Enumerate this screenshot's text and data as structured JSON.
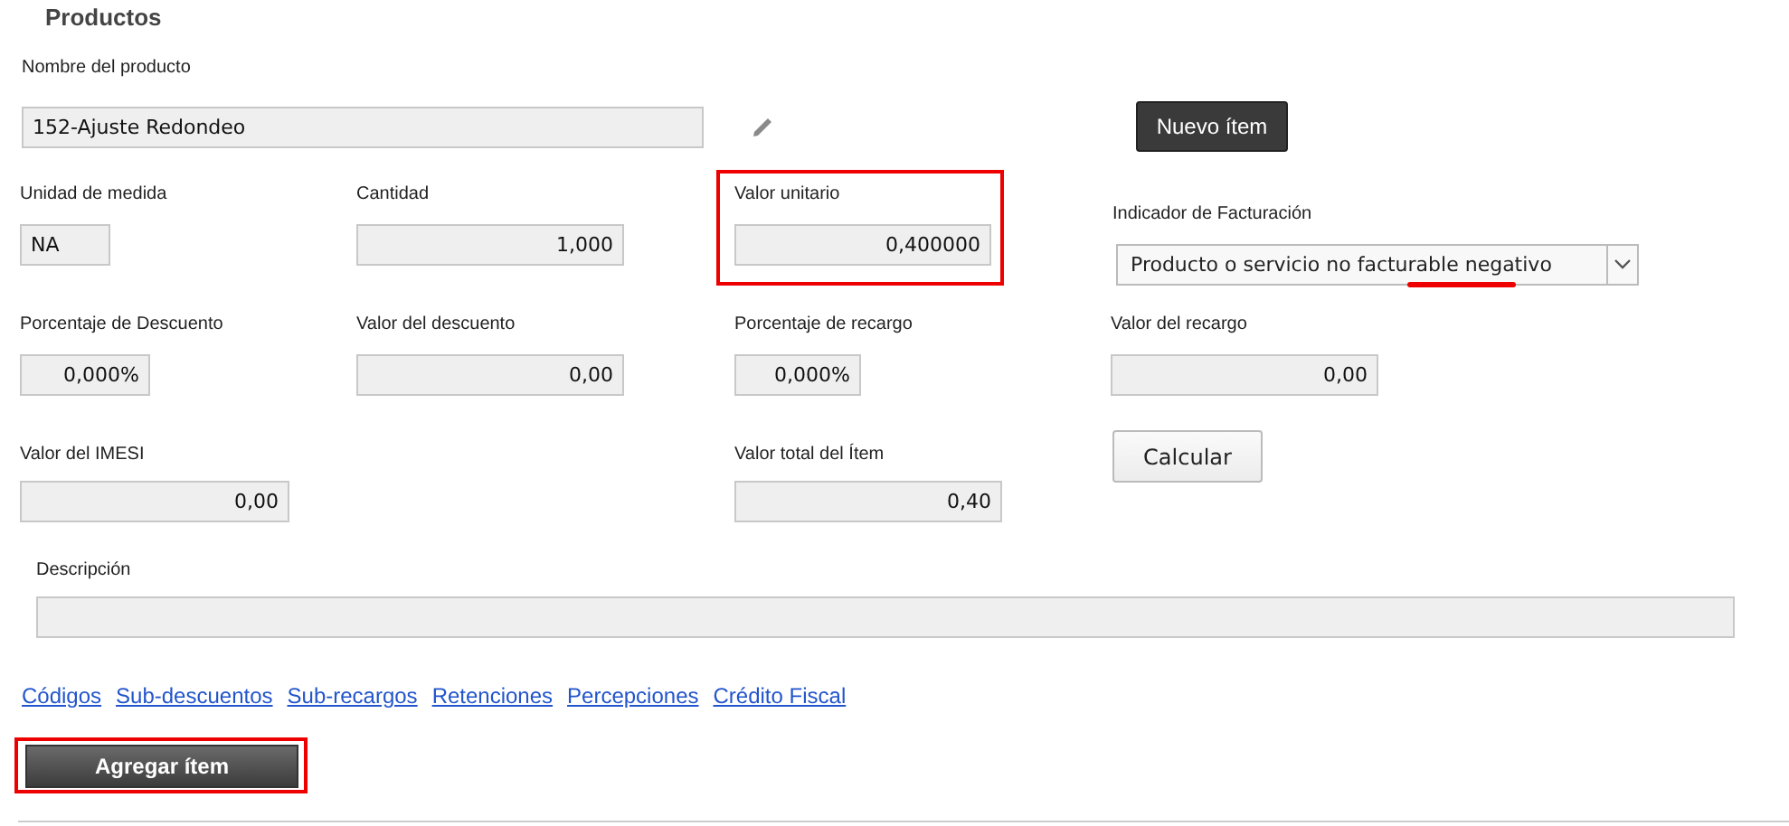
{
  "section_title": "Productos",
  "product_name": {
    "label": "Nombre del producto",
    "value": "152-Ajuste Redondeo"
  },
  "new_item_button": "Nuevo ítem",
  "fields": [
    {
      "label": "Unidad de medida",
      "value": "NA",
      "highlighted": false
    },
    {
      "label": "Cantidad",
      "value": "1,000",
      "highlighted": false
    },
    {
      "label": "Valor unitario",
      "value": "0,400000",
      "highlighted": true
    },
    {
      "kind": "select",
      "label": "Indicador de Facturación",
      "value": "Producto o servicio no facturable negativo",
      "highlighted": false
    },
    {
      "label": "Porcentaje de Descuento",
      "value": "0,000%",
      "highlighted": false
    },
    {
      "label": "Valor del descuento",
      "value": "0,00",
      "highlighted": false
    },
    {
      "label": "Porcentaje de recargo",
      "value": "0,000%",
      "highlighted": false
    },
    {
      "label": "Valor del recargo",
      "value": "0,00",
      "highlighted": false
    },
    {
      "label": "Valor del IMESI",
      "value": "0,00",
      "highlighted": false
    },
    {
      "kind": "empty"
    },
    {
      "label": "Valor total del Ítem",
      "value": "0,40",
      "highlighted": false
    },
    {
      "kind": "button",
      "label": "Calcular"
    }
  ],
  "description": {
    "label": "Descripción"
  },
  "links": [
    "Códigos",
    "Sub-descuentos",
    "Sub-recargos",
    "Retenciones",
    "Percepciones",
    "Crédito Fiscal"
  ],
  "add_item_button": {
    "label": "Agregar ítem",
    "highlighted": true
  }
}
